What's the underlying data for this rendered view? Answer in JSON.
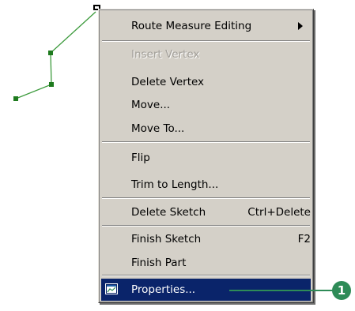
{
  "menu": {
    "items": [
      {
        "label": "Route Measure Editing",
        "has_submenu": true
      },
      {
        "label": "Insert Vertex",
        "disabled": true
      },
      {
        "label": "Delete Vertex"
      },
      {
        "label": "Move..."
      },
      {
        "label": "Move To..."
      },
      {
        "label": "Flip"
      },
      {
        "label": "Trim to Length..."
      },
      {
        "label": "Delete Sketch",
        "shortcut": "Ctrl+Delete"
      },
      {
        "label": "Finish Sketch",
        "shortcut": "F2"
      },
      {
        "label": "Finish Part"
      },
      {
        "label": "Properties...",
        "selected": true,
        "icon": "properties-icon"
      }
    ]
  },
  "callout": {
    "number": "1"
  },
  "colors": {
    "menu_background": "#d4d0c8",
    "selection": "#0a246a",
    "sketch_line": "#3c9a3c",
    "vertex": "#1e7a1e",
    "callout": "#2e8b57"
  }
}
